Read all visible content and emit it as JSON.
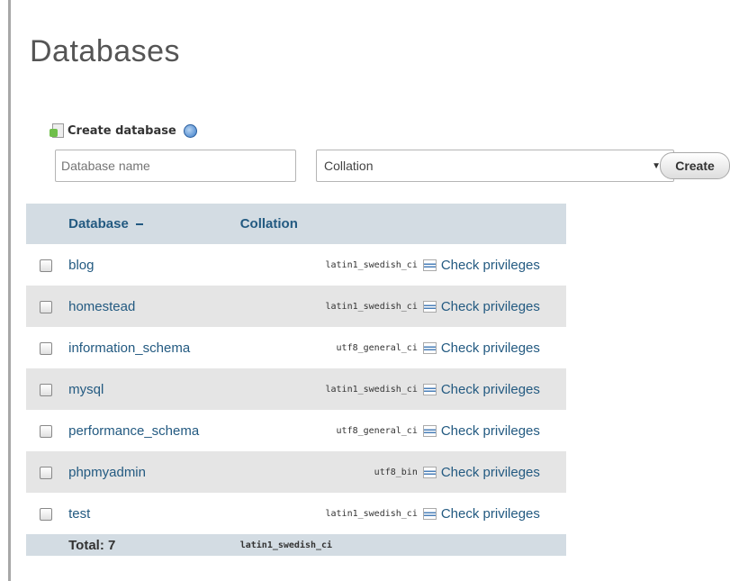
{
  "page": {
    "title": "Databases"
  },
  "create": {
    "heading": "Create database",
    "name_placeholder": "Database name",
    "collation_value": "Collation",
    "button_label": "Create"
  },
  "table": {
    "headers": {
      "database": "Database",
      "collation": "Collation"
    },
    "action_label": "Check privileges",
    "rows": [
      {
        "name": "blog",
        "collation": "latin1_swedish_ci"
      },
      {
        "name": "homestead",
        "collation": "latin1_swedish_ci"
      },
      {
        "name": "information_schema",
        "collation": "utf8_general_ci"
      },
      {
        "name": "mysql",
        "collation": "latin1_swedish_ci"
      },
      {
        "name": "performance_schema",
        "collation": "utf8_general_ci"
      },
      {
        "name": "phpmyadmin",
        "collation": "utf8_bin"
      },
      {
        "name": "test",
        "collation": "latin1_swedish_ci"
      }
    ],
    "total_label": "Total: 7",
    "total_collation": "latin1_swedish_ci"
  },
  "colors": {
    "accent": "#235a81",
    "header_bg": "#d3dce3",
    "row_alt": "#e5e5e5"
  }
}
